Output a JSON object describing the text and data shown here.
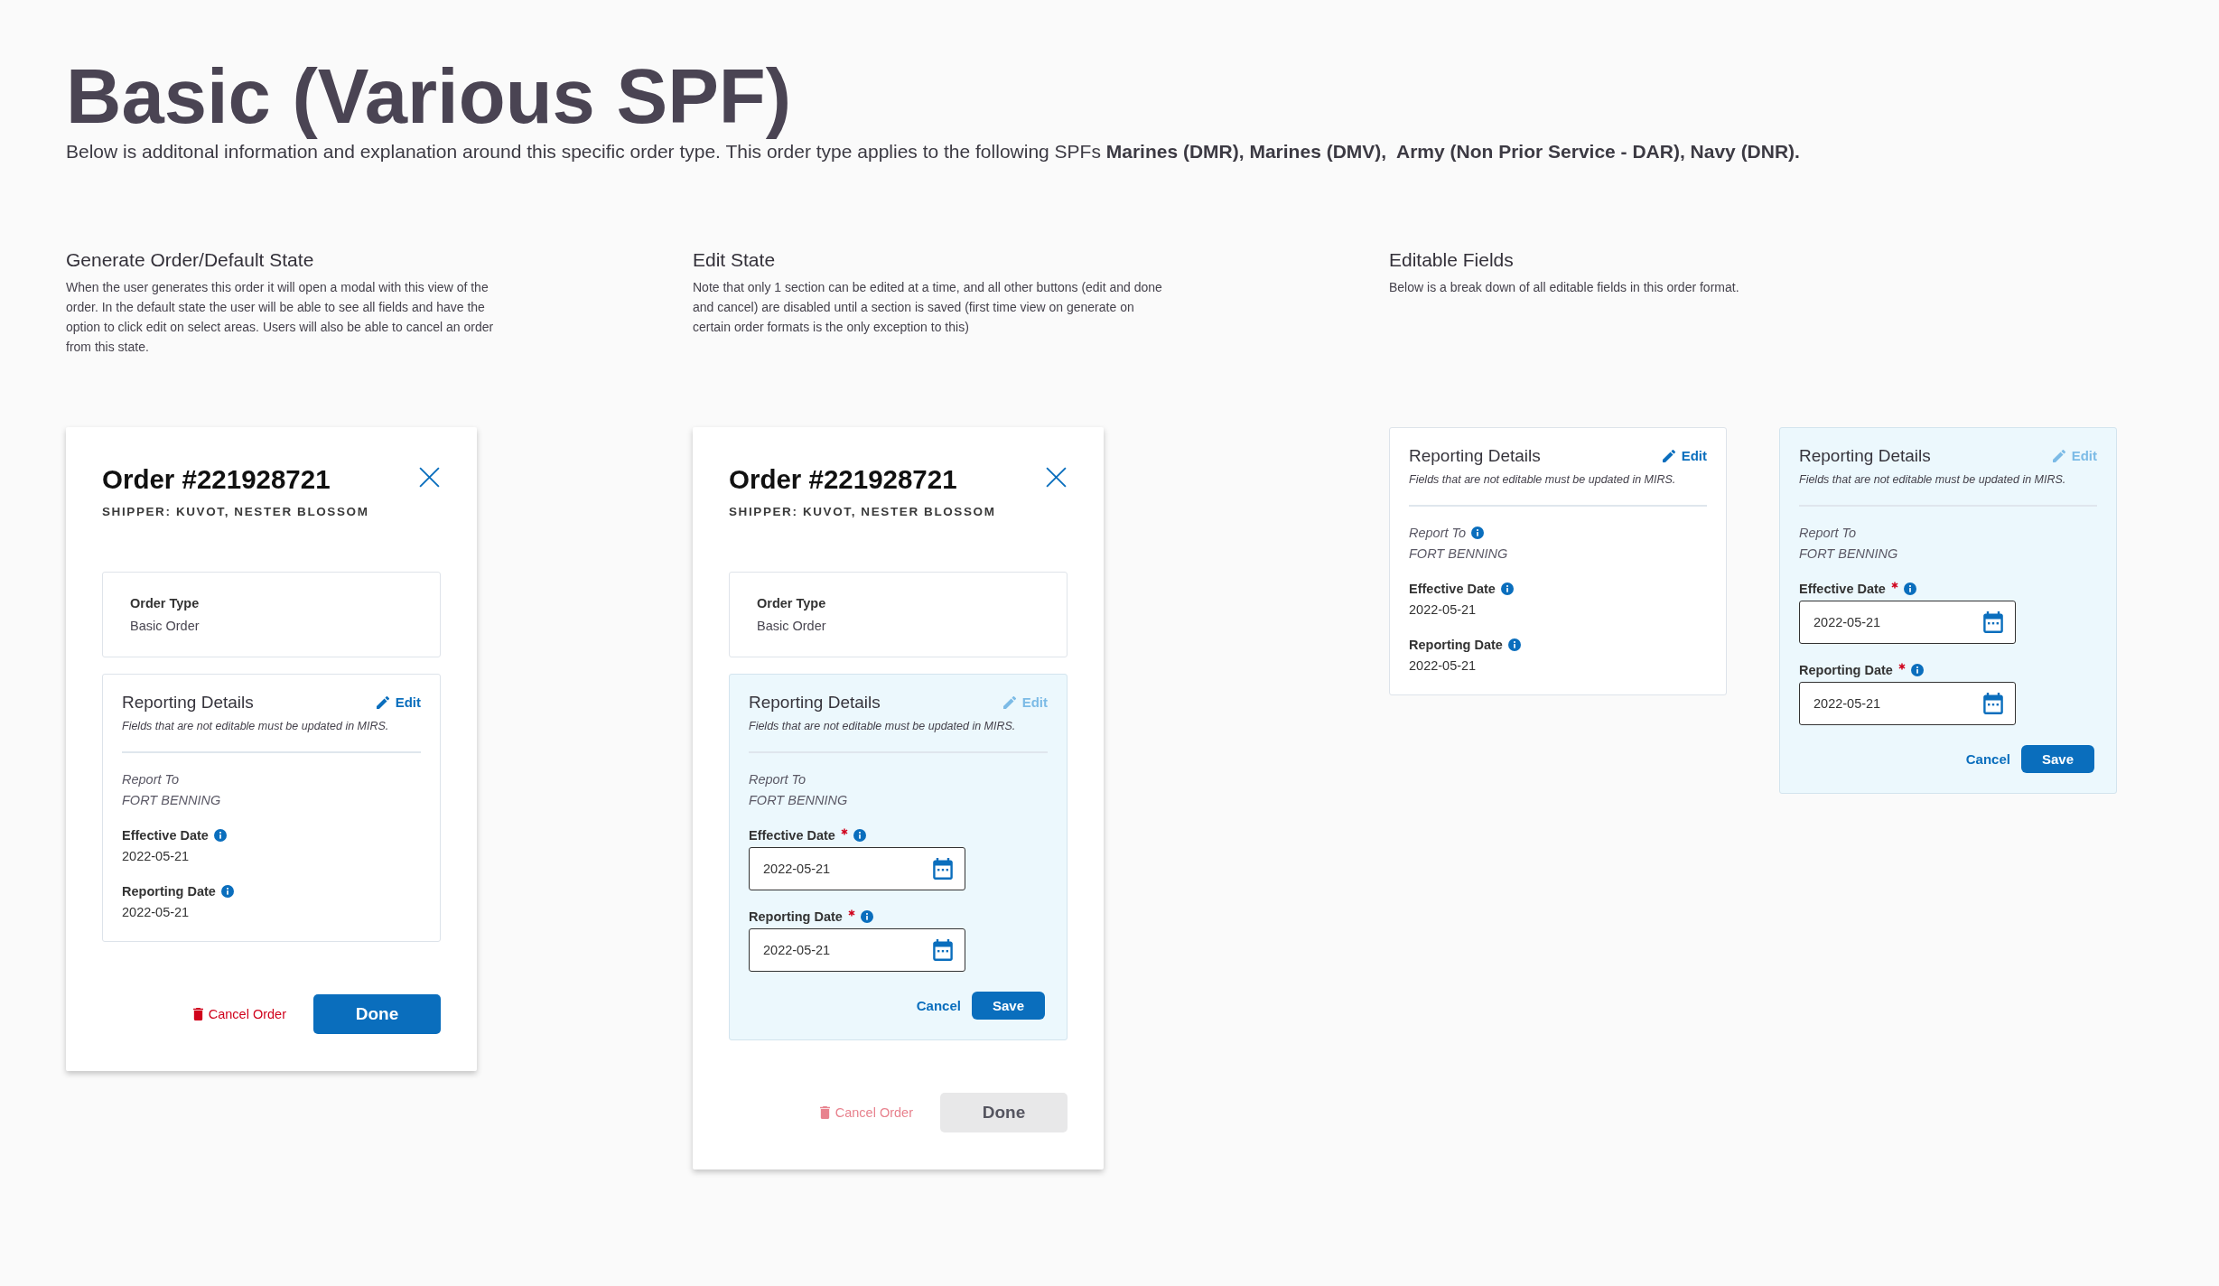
{
  "page": {
    "title": "Basic (Various SPF)",
    "intro": "Below is additonal information and explanation around this specific order type. This order type applies to the following SPFs **Marines (DMR), Marines (DMV),  Army (Non Prior Service - DAR), Navy (DNR).**"
  },
  "sections": [
    {
      "kind": "modal",
      "heading": "Generate Order/Default State",
      "description": "When the user generates this order it will open a modal with this view of the order. In the default state the user will be able to see all fields and have the option to click edit on select areas. Users will also be able to cancel an order from this state.",
      "modal": {
        "title": "Order #221928721",
        "subtitle": "SHIPPER: KUVOT, NESTER BLOSSOM",
        "order_type": {
          "label": "Order Type",
          "value": "Basic Order"
        },
        "details": {
          "title": "Reporting Details",
          "edit": {
            "label": "Edit",
            "disabled": false
          },
          "note": "Fields that are not editable must be updated in MIRS.",
          "editing": false,
          "fields": [
            {
              "kind": "locked",
              "label": "Report To",
              "value": "FORT BENNING",
              "info": false,
              "required": false
            },
            {
              "kind": "text",
              "label": "Effective Date",
              "value": "2022-05-21",
              "info": true,
              "required": false
            },
            {
              "kind": "text",
              "label": "Reporting Date",
              "value": "2022-05-21",
              "info": true,
              "required": false
            }
          ]
        },
        "cancel_order": {
          "label": "Cancel Order",
          "disabled": false
        },
        "done": {
          "label": "Done",
          "disabled": false
        }
      }
    },
    {
      "kind": "modal",
      "heading": "Edit State",
      "description": "Note that only 1 section can be edited at a time, and all other buttons (edit and done and cancel) are disabled until a section is saved (first time view on generate on certain order formats is the only exception to this)",
      "modal": {
        "title": "Order #221928721",
        "subtitle": "SHIPPER: KUVOT, NESTER BLOSSOM",
        "order_type": {
          "label": "Order Type",
          "value": "Basic Order"
        },
        "details": {
          "title": "Reporting Details",
          "edit": {
            "label": "Edit",
            "disabled": true
          },
          "note": "Fields that are not editable must be updated in MIRS.",
          "editing": true,
          "fields": [
            {
              "kind": "locked",
              "label": "Report To",
              "value": "FORT BENNING",
              "info": false,
              "required": false
            },
            {
              "kind": "date",
              "label": "Effective Date",
              "value": "2022-05-21",
              "info": true,
              "required": true
            },
            {
              "kind": "date",
              "label": "Reporting Date",
              "value": "2022-05-21",
              "info": true,
              "required": true
            }
          ],
          "buttons": [
            {
              "kind": "link",
              "label": "Cancel"
            },
            {
              "kind": "primary",
              "label": "Save"
            }
          ]
        },
        "cancel_order": {
          "label": "Cancel Order",
          "disabled": true
        },
        "done": {
          "label": "Done",
          "disabled": true
        }
      }
    },
    {
      "kind": "cards",
      "heading": "Editable Fields",
      "description": "Below is a break down of all editable fields in this order format.",
      "cards": [
        {
          "title": "Reporting Details",
          "edit": {
            "label": "Edit",
            "disabled": false
          },
          "note": "Fields that are not editable must be updated in MIRS.",
          "editing": false,
          "fields": [
            {
              "kind": "locked",
              "label": "Report To",
              "value": "FORT BENNING",
              "info": true,
              "required": false
            },
            {
              "kind": "text",
              "label": "Effective Date",
              "value": "2022-05-21",
              "info": true,
              "required": false
            },
            {
              "kind": "text",
              "label": "Reporting Date",
              "value": "2022-05-21",
              "info": true,
              "required": false
            }
          ]
        },
        {
          "title": "Reporting Details",
          "edit": {
            "label": "Edit",
            "disabled": true
          },
          "note": "Fields that are not editable must be updated in MIRS.",
          "editing": true,
          "fields": [
            {
              "kind": "locked",
              "label": "Report To",
              "value": "FORT BENNING",
              "info": false,
              "required": false
            },
            {
              "kind": "date",
              "label": "Effective Date",
              "value": "2022-05-21",
              "info": true,
              "required": true
            },
            {
              "kind": "date",
              "label": "Reporting Date",
              "value": "2022-05-21",
              "info": true,
              "required": true
            }
          ],
          "buttons": [
            {
              "kind": "link",
              "label": "Cancel"
            },
            {
              "kind": "primary",
              "label": "Save"
            }
          ]
        }
      ]
    }
  ]
}
